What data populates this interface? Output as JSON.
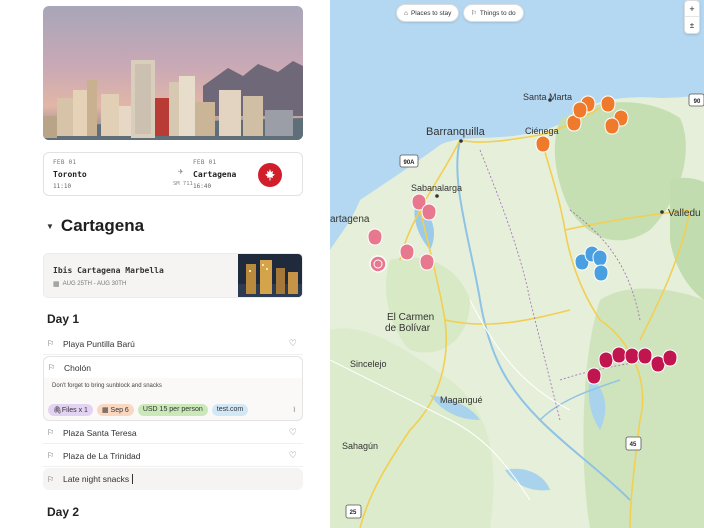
{
  "flight": {
    "from_date": "FEB 01",
    "from_city": "Toronto",
    "from_time": "11:10",
    "flight_no": "SM 711",
    "to_date": "FEB 01",
    "to_city": "Cartagena",
    "to_time": "16:40"
  },
  "section": {
    "title": "Cartagena"
  },
  "hotel": {
    "name": "Ibis Cartagena Marbella",
    "dates": "AUG 25TH - AUG 30TH"
  },
  "days": [
    {
      "label": "Day 1"
    },
    {
      "label": "Day 2"
    }
  ],
  "places": [
    {
      "name": "Playa Puntilla Barú"
    },
    {
      "name": "Cholón",
      "note": "Don't forget to bring sunblock and snacks"
    },
    {
      "name": "Plaza Santa Teresa"
    },
    {
      "name": "Plaza de La Trinidad"
    },
    {
      "name": "Late night snacks"
    }
  ],
  "chips": {
    "files": "Files x 1",
    "date": "Sep 6",
    "cost": "USD 15 per person",
    "link": "test.com"
  },
  "map": {
    "tab_places": "Places to stay",
    "tab_things": "Things to do",
    "zoom_in": "+",
    "zoom_out": "±",
    "labels": {
      "santa_marta": "Santa Marta",
      "barranquilla": "Barranquilla",
      "cienega": "Ciénega",
      "sabanalarga": "Sabanalarga",
      "cartagena": "artagena",
      "valledupar": "Valledu",
      "el_carmen": "El Carmen",
      "de_bolivar": "de Bolívar",
      "sincelejo": "Sincelejo",
      "magangue": "Magangué",
      "sahagun": "Sahagún"
    },
    "shields": {
      "s90a": "90A",
      "s90": "90",
      "s45": "45",
      "s25": "25"
    }
  },
  "colors": {
    "accent_red": "#c8234a",
    "pin_pink": "#e8788e",
    "pin_orange": "#f07a2c",
    "pin_blue": "#4a9fe0",
    "pin_crimson": "#c0154f",
    "chip_files": "#e3d3f2",
    "chip_date": "#f9d7c1",
    "chip_cost": "#cbe9b8",
    "chip_link": "#d3e8f6"
  }
}
